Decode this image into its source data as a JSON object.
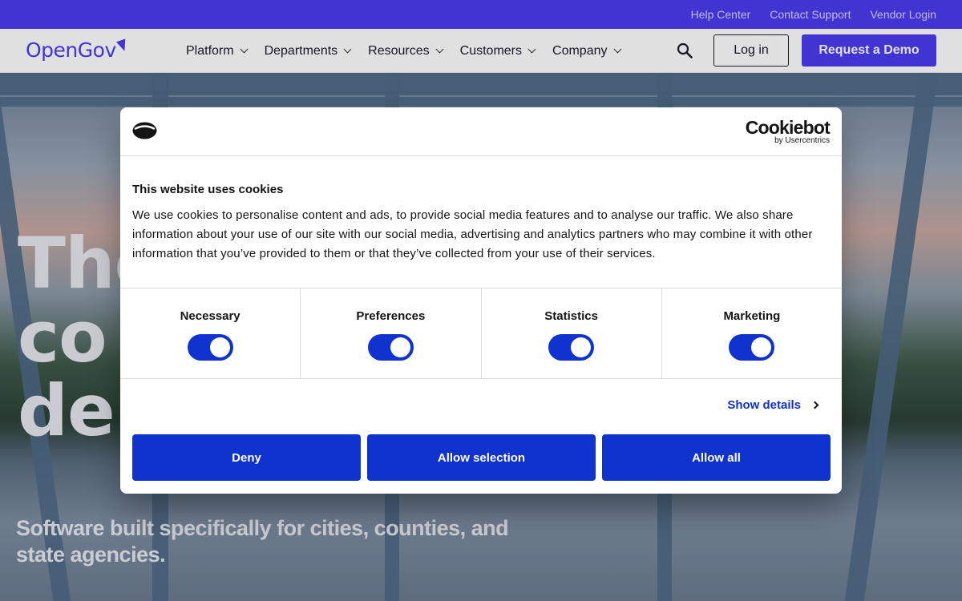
{
  "utility_bar": {
    "links": [
      "Help Center",
      "Contact Support",
      "Vendor Login"
    ]
  },
  "nav": {
    "logo_text": "OpenGov",
    "items": [
      "Platform",
      "Departments",
      "Resources",
      "Customers",
      "Company"
    ],
    "login_label": "Log in",
    "demo_label": "Request a Demo"
  },
  "hero": {
    "heading_lines": [
      "The",
      "co",
      "de"
    ],
    "subheading": "Software built specifically for cities, counties, and state agencies."
  },
  "cookie": {
    "brand_name": "Cookiebot",
    "brand_by": "by Usercentrics",
    "title": "This website uses cookies",
    "body": "We use cookies to personalise content and ads, to provide social media features and to analyse our traffic. We also share information about your use of our site with our social media, advertising and analytics partners who may combine it with other information that you’ve provided to them or that they’ve collected from your use of their services.",
    "categories": [
      {
        "label": "Necessary",
        "enabled": true
      },
      {
        "label": "Preferences",
        "enabled": true
      },
      {
        "label": "Statistics",
        "enabled": true
      },
      {
        "label": "Marketing",
        "enabled": true
      }
    ],
    "show_details_label": "Show details",
    "buttons": {
      "deny": "Deny",
      "allow_selection": "Allow selection",
      "allow_all": "Allow all"
    },
    "accent_color": "#1032cf"
  },
  "colors": {
    "brand": "#4a3cf0"
  }
}
